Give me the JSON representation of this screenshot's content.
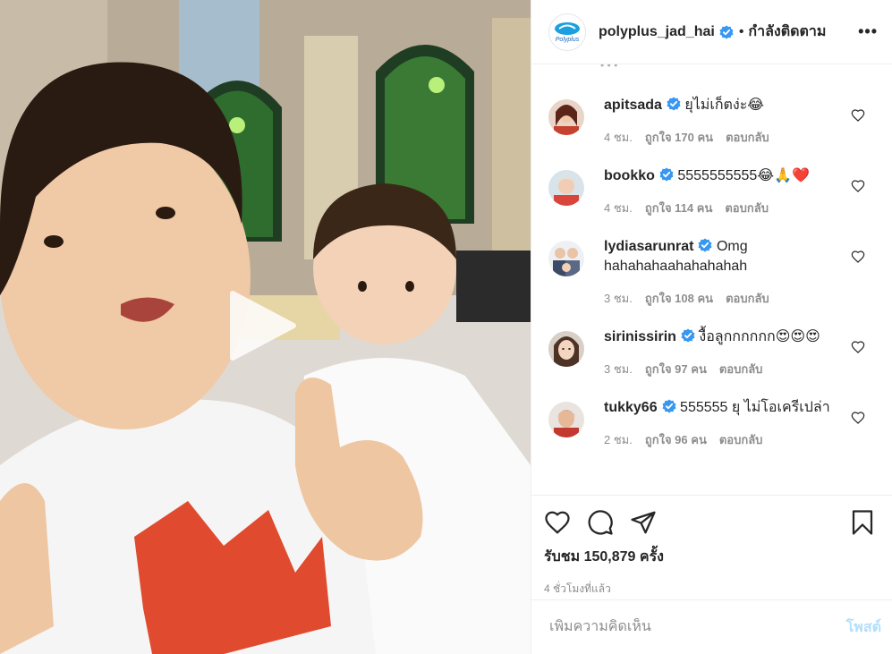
{
  "header": {
    "username": "polyplus_jad_hai",
    "separator": "•",
    "follow_label": "กำลังติดตาม",
    "more_label": "•••",
    "logo_text": "Polyplus"
  },
  "comments": [
    {
      "username": "apitsada",
      "text": "ยุไม่เก็ตง่ะ😂",
      "time": "4 ชม.",
      "likes": "ถูกใจ 170 คน",
      "reply": "ตอบกลับ",
      "avatar_color": "#c7412f"
    },
    {
      "username": "bookko",
      "text": "5555555555😂🙏❤️",
      "time": "4 ชม.",
      "likes": "ถูกใจ 114 คน",
      "reply": "ตอบกลับ",
      "avatar_color": "#d9443b"
    },
    {
      "username": "lydiasarunrat",
      "text": "Omg hahahahaahahahahah",
      "time": "3 ชม.",
      "likes": "ถูกใจ 108 คน",
      "reply": "ตอบกลับ",
      "avatar_color": "#5a6a86"
    },
    {
      "username": "sirinissirin",
      "text": "งื้อลูกกกกกก😍😍😍",
      "time": "3 ชม.",
      "likes": "ถูกใจ 97 คน",
      "reply": "ตอบกลับ",
      "avatar_color": "#b58b76"
    },
    {
      "username": "tukky66",
      "text": "555555 ยุ ไม่โอเครีเปล่า",
      "time": "2 ชม.",
      "likes": "ถูกใจ 96 คน",
      "reply": "ตอบกลับ",
      "avatar_color": "#c3382f"
    }
  ],
  "stats": {
    "views": "รับชม 150,879 ครั้ง",
    "time_ago": "4 ชั่วโมงที่แล้ว"
  },
  "add_comment": {
    "placeholder": "เพิ่มความคิดเห็น",
    "post_label": "โพสต์"
  },
  "colors": {
    "verified": "#3897f0",
    "post_button": "#b2dffc",
    "muted": "#8e8e8e"
  },
  "icons": [
    "play-icon",
    "verified-icon",
    "heart-icon",
    "comment-icon",
    "share-icon",
    "bookmark-icon",
    "more-icon"
  ]
}
